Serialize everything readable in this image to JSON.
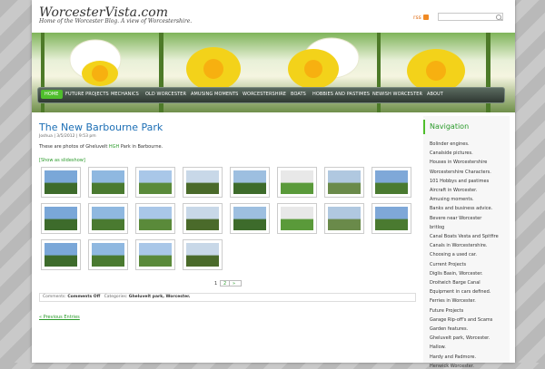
{
  "site": {
    "title": "WorcesterVista.com",
    "description": "Home of the Worcester Blog. A view of Worcestershire.",
    "rss_label": "rss"
  },
  "nav": [
    "Home",
    "Future Projects",
    "Mechanics",
    "Old Worcester",
    "Amusing Moments",
    "Worcestershire",
    "Boats",
    "Hobbies and Pastimes",
    "Newish Worcester",
    "About"
  ],
  "post": {
    "title": "The New Barbourne Park",
    "meta": "Joshua | 3/5/2012 | 9:53 pm",
    "text_before": "These are photos of Gheluvelt ",
    "text_highlight": "HGH",
    "text_after": " Park in Barbourne.",
    "slideshow_link": "[Show as slideshow]",
    "pages": [
      "1",
      "2",
      "»"
    ],
    "comments_label": "Comments:",
    "comments_value": "Comments Off",
    "categories_label": "Categories:",
    "categories_value": "Gheluvelt park, Worcester."
  },
  "previous_entries": "« Previous Entries",
  "sidebar": {
    "heading": "Navigation",
    "items": [
      "Bolinder engines.",
      "Canalside pictures.",
      "Houses in Worcestershire",
      "Worcestershire Characters.",
      "101 Hobbys and pastimes",
      "Aircraft in Worcester.",
      "Amusing moments.",
      "Banks and business advice.",
      "Bevere near Worcester",
      "britlog",
      "Canal Boats Vesta and Spitfire",
      "Canals in Worcestershire.",
      "Choosing a used car.",
      "Current Projects",
      "Diglis Basin, Worcester.",
      "Droitwich Barge Canal",
      "Equipment in cars defined.",
      "Ferries in Worcester.",
      "Future Projects",
      "Garage Rip-off's and Scams",
      "Garden features.",
      "Gheluvelt park, Worcester.",
      "Hallow.",
      "Hardy and Padmore.",
      "Henwick Worcester."
    ]
  },
  "colors": {
    "accent": "#4fbe2c",
    "link": "#1d6fb5",
    "green_text": "#2a9a2a"
  }
}
